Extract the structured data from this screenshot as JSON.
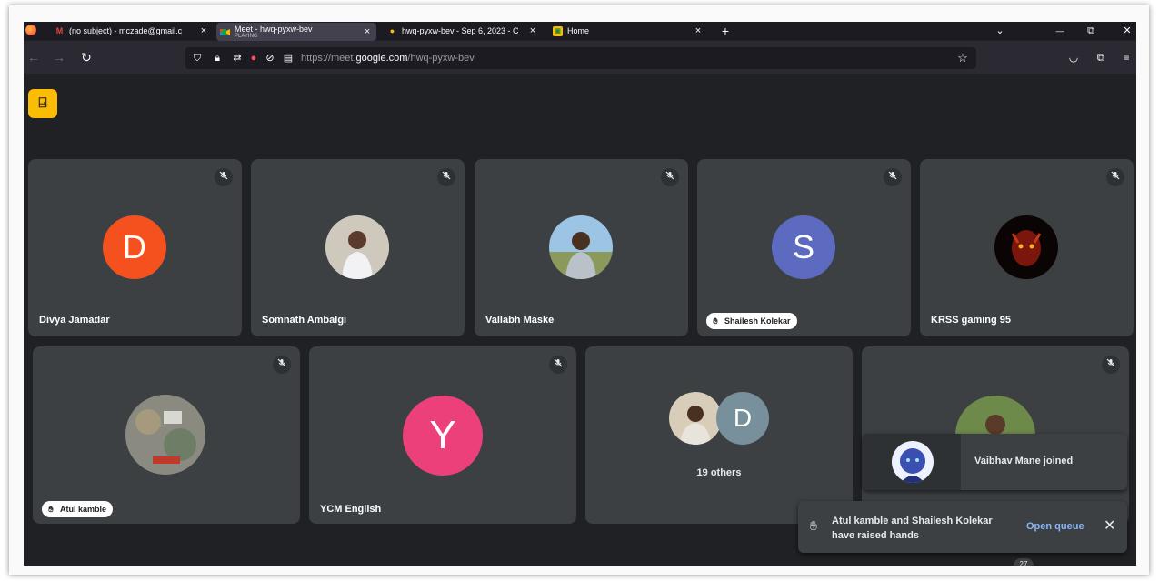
{
  "browser": {
    "tabs": [
      {
        "title": "(no subject) - mczade@gmail.c",
        "favicon": "gmail-icon",
        "close": "×"
      },
      {
        "title": "Meet - hwq-pyxw-bev",
        "subtitle": "PLAYING",
        "favicon": "meet-icon",
        "close": "×"
      },
      {
        "title": "hwq-pyxw-bev - Sep 6, 2023 - C",
        "favicon": "thumb-icon",
        "close": "×"
      },
      {
        "title": "Home",
        "favicon": "classroom-icon",
        "close": "×"
      }
    ],
    "new_tab": "+",
    "list_all_tabs": "⌄",
    "window_controls": {
      "minimize": "—",
      "restore": "⧉",
      "close": "✕"
    },
    "nav": {
      "back": "←",
      "forward": "→",
      "reload": "↻"
    },
    "url": {
      "prefix": "https://meet.",
      "domain": "google.com",
      "path": "/hwq-pyxw-bev"
    }
  },
  "meet": {
    "exit_icon": "⍈",
    "tiles": [
      {
        "name": "Divya Jamadar",
        "initial": "D",
        "avatar_color": "#f4511e",
        "muted": true
      },
      {
        "name": "Somnath Ambalgi",
        "muted": true
      },
      {
        "name": "Vallabh Maske",
        "muted": true
      },
      {
        "name": "Shailesh Kolekar",
        "initial": "S",
        "avatar_color": "#5c6bc0",
        "muted": true,
        "hand_raised": true
      },
      {
        "name": "KRSS gaming 95",
        "muted": true
      },
      {
        "name": "Atul kamble",
        "muted": true,
        "hand_raised": true
      },
      {
        "name": "YCM English",
        "initial": "Y",
        "avatar_color": "#ec407a",
        "muted": true
      },
      {
        "others_label": "19 others",
        "initial": "D",
        "avatar_color": "#78909c"
      },
      {
        "muted": true
      }
    ],
    "join_toast": {
      "text": "Vaibhav Mane joined"
    },
    "hands_toast": {
      "line1": "Atul kamble and Shailesh Kolekar",
      "line2": "have raised hands",
      "action": "Open queue",
      "close": "✕"
    },
    "badge": "27"
  }
}
